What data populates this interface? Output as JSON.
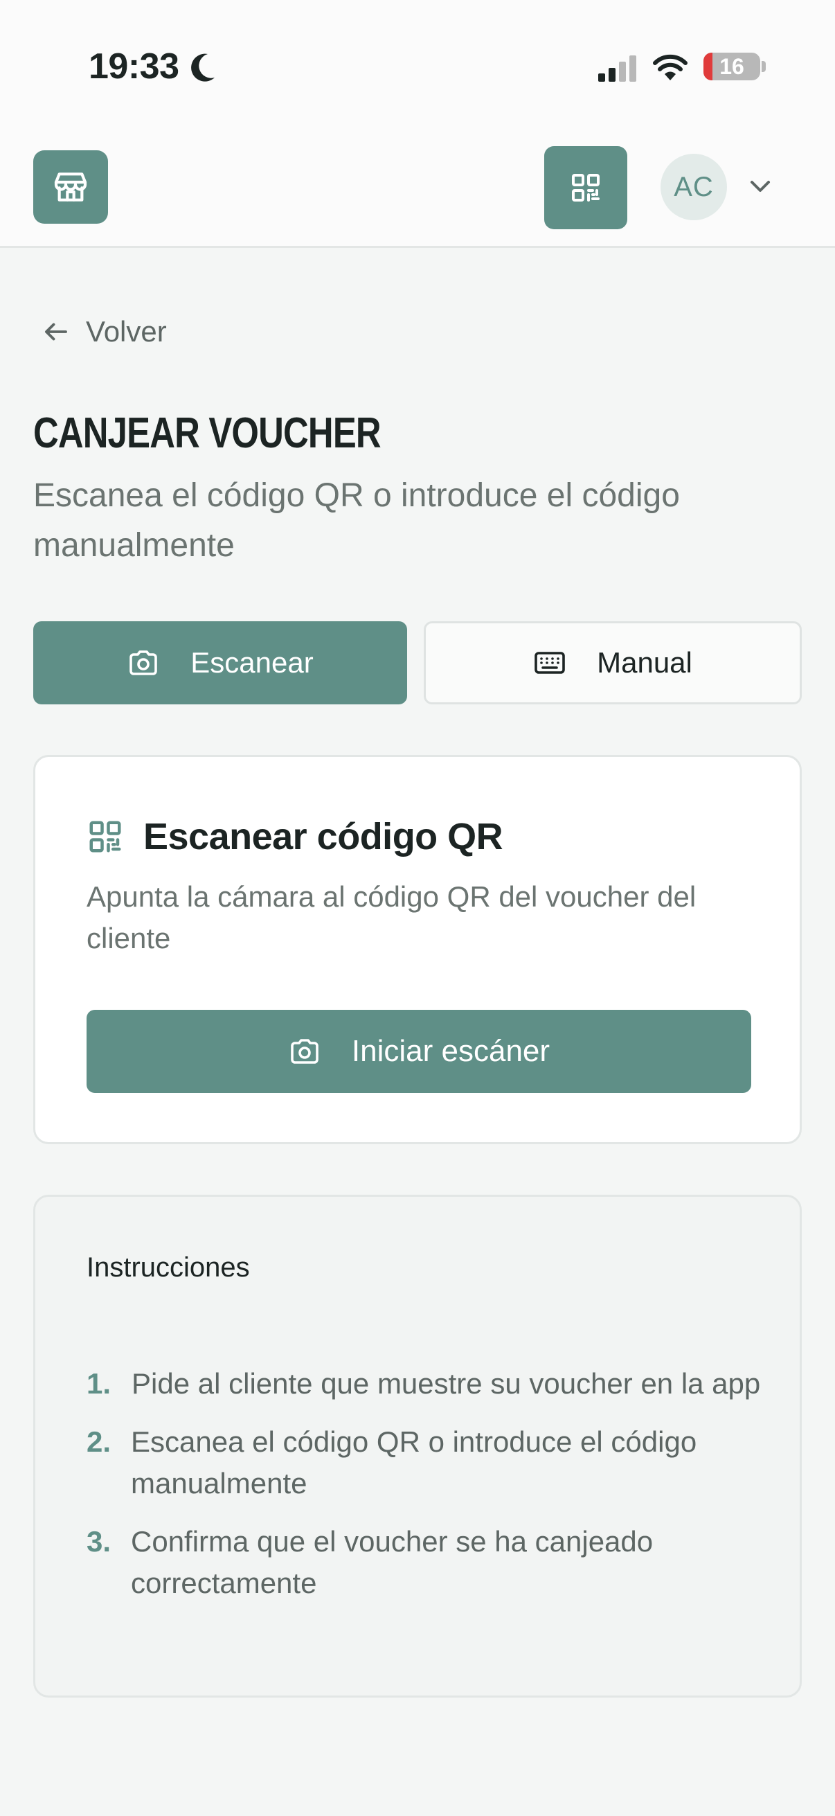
{
  "status_bar": {
    "time": "19:33",
    "battery": "16"
  },
  "header": {
    "avatar_initials": "AC",
    "icons": [
      "store-icon",
      "qr-code-icon",
      "chevron-down-icon"
    ]
  },
  "back_link": {
    "label": "Volver"
  },
  "page": {
    "title": "CANJEAR VOUCHER",
    "subtitle": "Escanea el código QR o introduce el código manualmente"
  },
  "modes": {
    "scan_label": "Escanear",
    "manual_label": "Manual",
    "selected": "Escanear"
  },
  "scan_card": {
    "title": "Escanear código QR",
    "description": "Apunta la cámara al código QR del voucher del cliente",
    "button_label": "Iniciar escáner"
  },
  "instructions": {
    "title": "Instrucciones",
    "steps": [
      {
        "number": "1.",
        "text": "Pide al cliente que muestre su voucher en la app"
      },
      {
        "number": "2.",
        "text": "Escanea el código QR o introduce el código manualmente"
      },
      {
        "number": "3.",
        "text": "Confirma que el voucher se ha canjeado correctamente"
      }
    ]
  },
  "colors": {
    "accent": "#5f8f87",
    "background": "#f4f6f5",
    "battery_low": "#e03b3b"
  }
}
